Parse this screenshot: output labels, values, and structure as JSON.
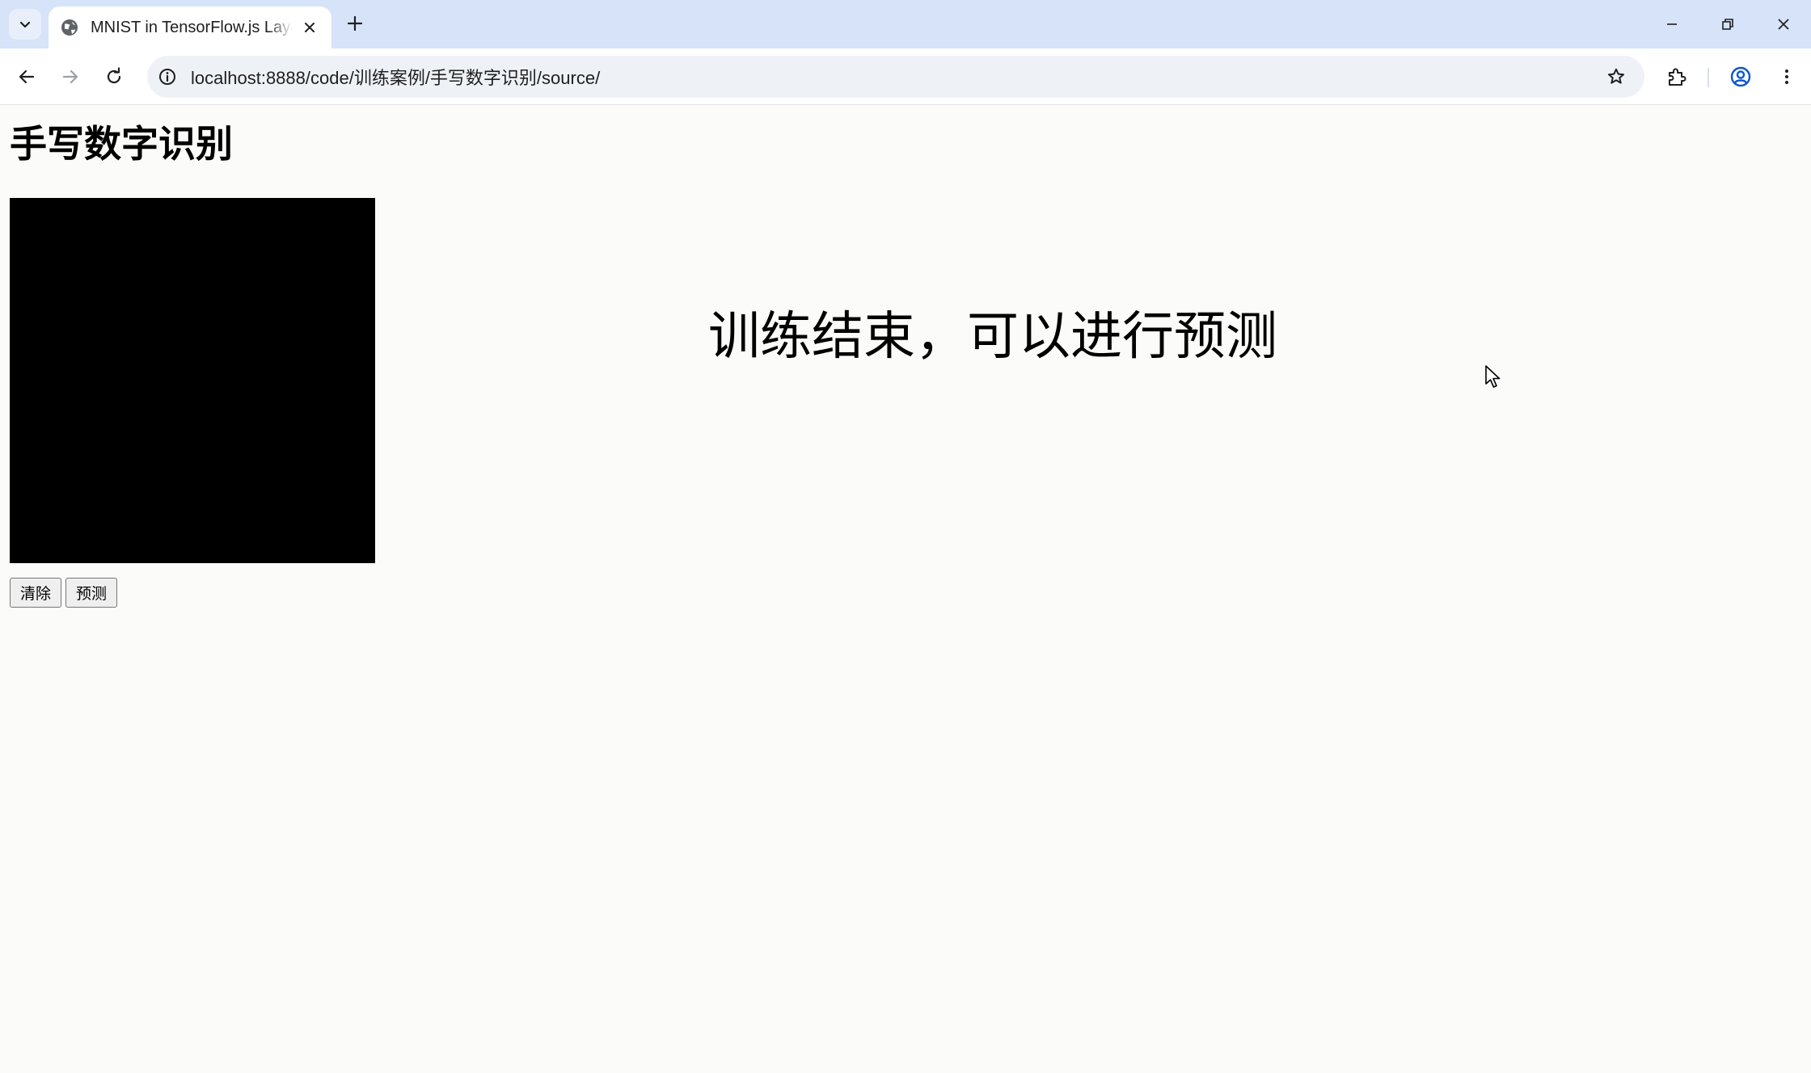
{
  "browser": {
    "tab": {
      "title": "MNIST in TensorFlow.js Layers"
    },
    "address_bar": {
      "url": "localhost:8888/code/训练案例/手写数字识别/source/"
    }
  },
  "page": {
    "title": "手写数字识别",
    "status": "训练结束，可以进行预测",
    "buttons": {
      "clear": "清除",
      "predict": "预测"
    },
    "canvas_color": "#000000"
  },
  "colors": {
    "tabstrip_bg": "#d6e3f8",
    "page_bg": "#fbfbfa",
    "accent": "#0b57d0"
  }
}
